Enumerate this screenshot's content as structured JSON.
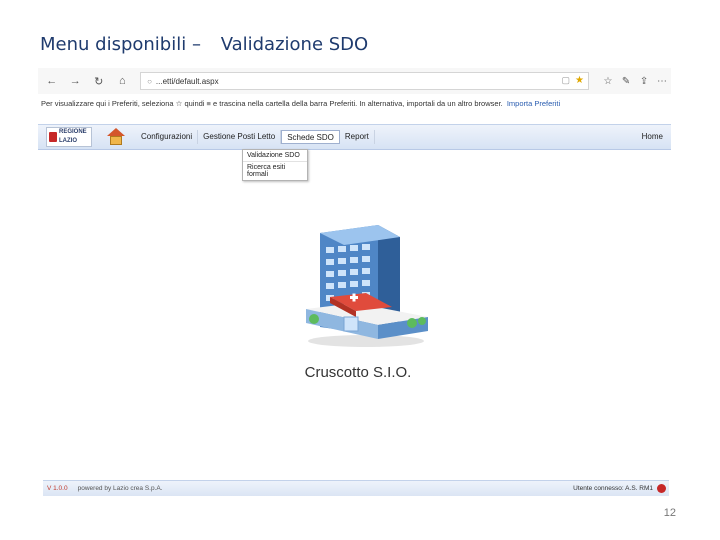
{
  "slide": {
    "title_part1": "Menu disponibili –",
    "title_part2": "Validazione SDO",
    "page_number": "12"
  },
  "browser": {
    "address": "...etti/default.aspx",
    "favorites_text": "Per visualizzare qui i Preferiti, seleziona ☆ quindi ≡ e trascina nella cartella della barra Preferiti. In alternativa, importali da un altro browser.",
    "favorites_link": "Importa Preferiti"
  },
  "app": {
    "logo_text_line1": "REGIONE",
    "logo_text_line2": "LAZIO",
    "menu": [
      "Configurazioni",
      "Gestione Posti Letto",
      "Schede SDO",
      "Report"
    ],
    "home_label": "Home",
    "dropdown": [
      "Validazione SDO",
      "Ricerca esiti formali"
    ],
    "caption": "Cruscotto S.I.O.",
    "footer_version": "V 1.0.0",
    "footer_powered": "powered by Lazio crea S.p.A.",
    "footer_user": "Utente connesso: A.S. RM1"
  },
  "colors": {
    "title": "#1f3b6e",
    "header_bg": "#d7e3f4",
    "accent_red": "#c62828"
  }
}
